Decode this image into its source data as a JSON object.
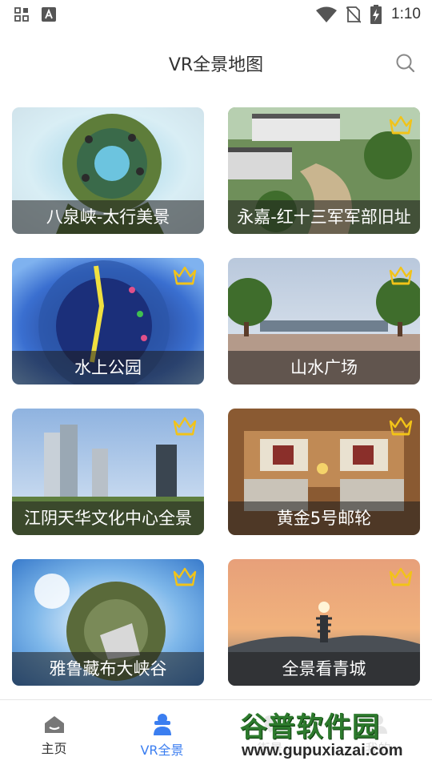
{
  "status_bar": {
    "time": "1:10"
  },
  "header": {
    "title": "VR全景地图"
  },
  "cards": [
    {
      "caption": "八泉峡-太行美景"
    },
    {
      "caption": "永嘉-红十三军军部旧址"
    },
    {
      "caption": "水上公园"
    },
    {
      "caption": "山水广场"
    },
    {
      "caption": "江阴天华文化中心全景"
    },
    {
      "caption": "黄金5号邮轮"
    },
    {
      "caption": "雅鲁藏布大峡谷"
    },
    {
      "caption": "全景看青城"
    }
  ],
  "tabs": [
    {
      "label": "主页",
      "icon": "home-icon"
    },
    {
      "label": "VR全景",
      "icon": "vr-person-icon"
    },
    {
      "label": "街景",
      "icon": "street-icon"
    },
    {
      "label": "我的",
      "icon": "profile-icon"
    }
  ],
  "watermark": {
    "name": "谷普软件园",
    "url": "www.gupuxiazai.com"
  },
  "colors": {
    "accent": "#3b7ef0",
    "crown": "#f2c318",
    "caption_bg": "rgba(30,30,30,0.55)"
  }
}
